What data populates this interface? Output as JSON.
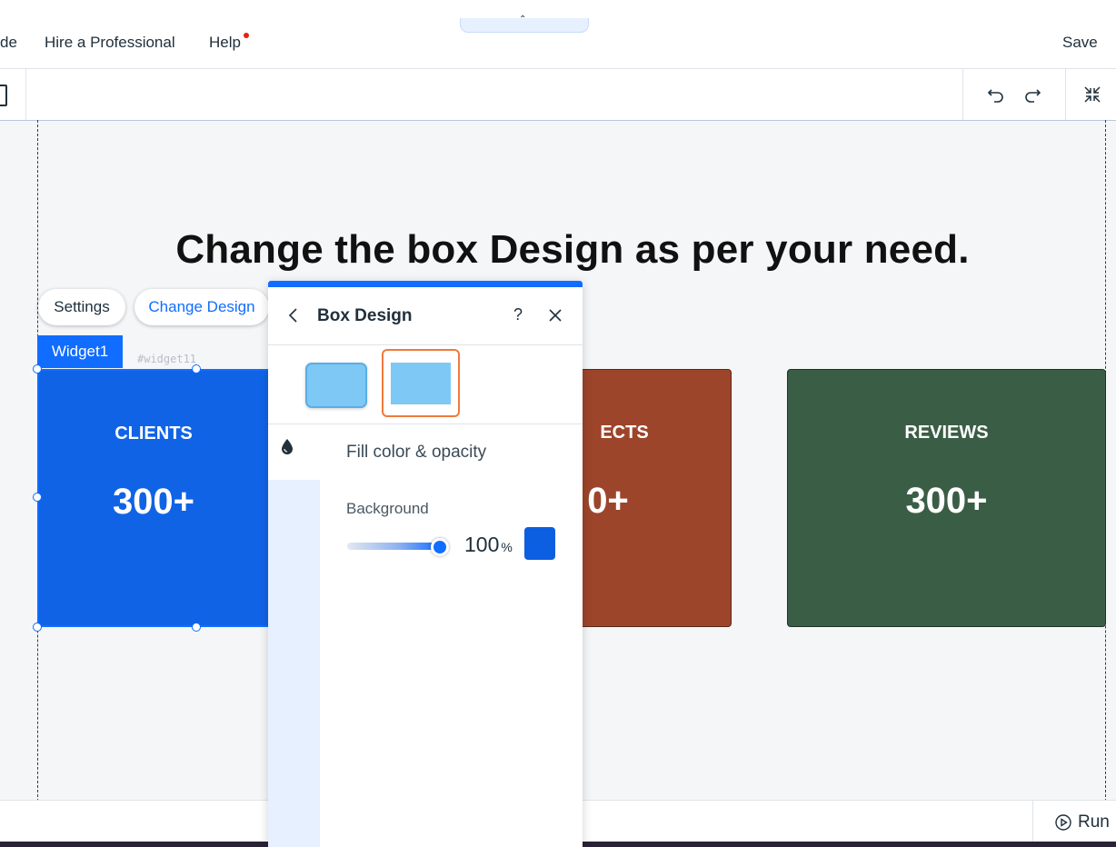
{
  "topbar": {
    "nav_partial": "de",
    "hire": "Hire a Professional",
    "help": "Help",
    "save": "Save"
  },
  "canvas": {
    "headline": "Change the box Design as per your need.",
    "settings_button": "Settings",
    "change_design_button": "Change Design",
    "widget_tag": "Widget1",
    "widget_id": "#widget11",
    "boxes": [
      {
        "title": "CLIENTS",
        "value": "300+",
        "color": "#1163e6"
      },
      {
        "title": "ECTS",
        "value": "0+",
        "color": "#9d452b"
      },
      {
        "title": "REVIEWS",
        "value": "300+",
        "color": "#3a5e45"
      }
    ]
  },
  "panel": {
    "title": "Box Design",
    "help_glyph": "?",
    "section_title": "Fill color & opacity",
    "background_label": "Background",
    "opacity_value": "100",
    "opacity_unit": "%",
    "opacity_fraction": 1.0,
    "fill_color": "#0b5fe0"
  },
  "bottombar": {
    "run": "Run"
  },
  "colors": {
    "accent": "#116dff",
    "selected_thumb_border": "#f07a3a",
    "thumb_fill": "#7ec8f6"
  },
  "icons": [
    "undo-icon",
    "redo-icon",
    "collapse-icon",
    "back-chevron-icon",
    "close-icon",
    "drop-icon",
    "run-icon"
  ]
}
